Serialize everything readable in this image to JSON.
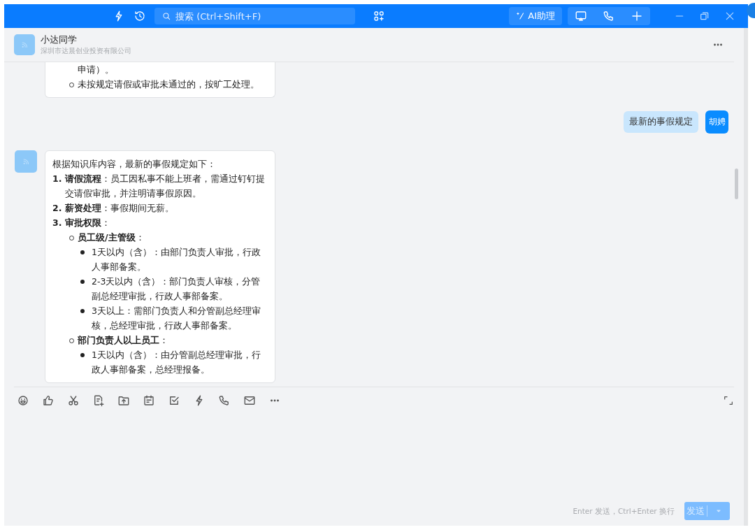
{
  "title_bar": {
    "search": {
      "placeholder": "搜索 (Ctrl+Shift+F)"
    },
    "ai_button": "AI助理"
  },
  "chat_header": {
    "name": "小达同学",
    "organization": "深圳市达晨创业投资有限公司"
  },
  "messages": [
    {
      "kind": "bot",
      "lines": [
        {
          "kind": "continuation",
          "text": "申请）。"
        },
        {
          "kind": "circle",
          "text": "未按规定请假或审批未通过的，按旷工处理。"
        }
      ]
    },
    {
      "kind": "user",
      "text": "最新的事假规定",
      "avatar": "胡娉"
    },
    {
      "kind": "bot",
      "lines": [
        {
          "kind": "paragraph",
          "text": "根据知识库内容，最新的事假规定如下："
        },
        {
          "kind": "numbered",
          "marker": "1.",
          "text": "**请假流程**：员工因私事不能上班者，需通过钉钉提交请假审批，并注明请事假原因。"
        },
        {
          "kind": "numbered",
          "marker": "2.",
          "text": "**薪资处理**：事假期间无薪。"
        },
        {
          "kind": "numbered",
          "marker": "3.",
          "text": "**审批权限**："
        },
        {
          "kind": "circle",
          "text": "**员工级/主管级**："
        },
        {
          "kind": "disc",
          "text": "1天以内（含）：由部门负责人审批，行政人事部备案。"
        },
        {
          "kind": "disc",
          "text": "2-3天以内（含）：部门负责人审核，分管副总经理审批，行政人事部备案。"
        },
        {
          "kind": "disc",
          "text": "3天以上：需部门负责人和分管副总经理审核，总经理审批，行政人事部备案。"
        },
        {
          "kind": "circle",
          "text": "**部门负责人以上员工**："
        },
        {
          "kind": "disc",
          "text": "1天以内（含）：由分管副总经理审批，行政人事部备案，总经理报备。"
        }
      ]
    }
  ],
  "composer": {
    "hint": "Enter 发送，Ctrl+Enter 换行",
    "send_button": {
      "label": "发送",
      "disabled": true
    }
  }
}
